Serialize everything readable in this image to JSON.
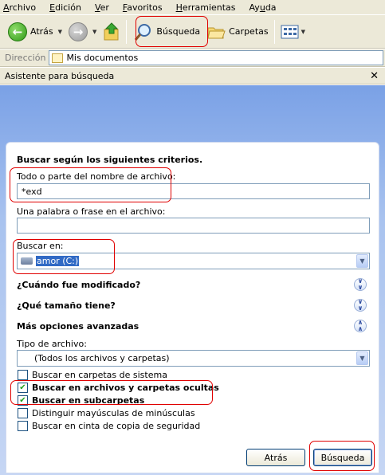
{
  "menu": [
    "Archivo",
    "Edición",
    "Ver",
    "Favoritos",
    "Herramientas",
    "Ayuda"
  ],
  "toolbar": {
    "back": "Atrás",
    "search": "Búsqueda",
    "folders": "Carpetas"
  },
  "address": {
    "label": "Dirección",
    "value": "Mis documentos"
  },
  "panel_title": "Asistente para búsqueda",
  "form": {
    "heading": "Buscar según los siguientes criterios.",
    "filename_label": "Todo o parte del nombre de archivo:",
    "filename_value": "*exd",
    "phrase_label": "Una palabra o frase en el archivo:",
    "phrase_value": "",
    "lookin_label": "Buscar en:",
    "lookin_value": "amor (C:)",
    "when_modified": "¿Cuándo fue modificado?",
    "what_size": "¿Qué tamaño tiene?",
    "advanced": "Más opciones avanzadas",
    "filetype_label": "Tipo de archivo:",
    "filetype_value": "(Todos los archivos y carpetas)",
    "options": [
      {
        "label": "Buscar en carpetas de sistema",
        "checked": false
      },
      {
        "label": "Buscar en archivos y carpetas ocultas",
        "checked": true
      },
      {
        "label": "Buscar en subcarpetas",
        "checked": true
      },
      {
        "label": "Distinguir mayúsculas de minúsculas",
        "checked": false
      },
      {
        "label": "Buscar en cinta de copia de seguridad",
        "checked": false
      }
    ],
    "back_button": "Atrás",
    "search_button": "Búsqueda"
  },
  "annotation_color": "#e00000"
}
